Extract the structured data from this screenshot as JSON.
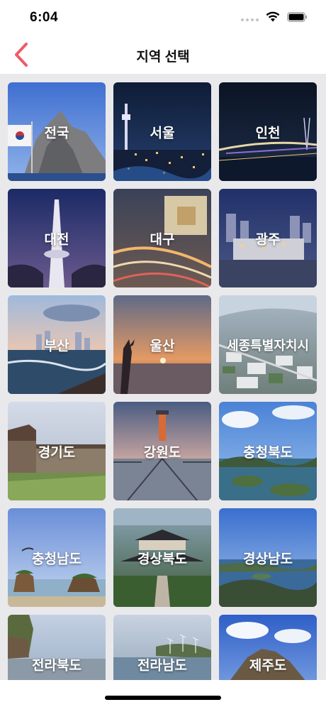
{
  "status_bar": {
    "time": "6:04"
  },
  "nav": {
    "title": "지역 선택",
    "accent_color": "#ef5b67"
  },
  "regions": [
    {
      "label": "전국",
      "scene": "national-flag-rock-island"
    },
    {
      "label": "서울",
      "scene": "seoul-night-tower"
    },
    {
      "label": "인천",
      "scene": "incheon-bridge-night"
    },
    {
      "label": "대전",
      "scene": "daejeon-tower-dusk"
    },
    {
      "label": "대구",
      "scene": "daegu-traffic-night"
    },
    {
      "label": "광주",
      "scene": "gwangju-city-dusk"
    },
    {
      "label": "부산",
      "scene": "busan-beach-sunset"
    },
    {
      "label": "울산",
      "scene": "ulsan-sunrise-sea"
    },
    {
      "label": "세종특별자치시",
      "scene": "sejong-aerial-city"
    },
    {
      "label": "경기도",
      "scene": "gyeonggi-fortress-wall"
    },
    {
      "label": "강원도",
      "scene": "gangwon-lighthouse-pier"
    },
    {
      "label": "충청북도",
      "scene": "chungbuk-lake-islands"
    },
    {
      "label": "충청남도",
      "scene": "chungnam-rock-islets"
    },
    {
      "label": "경상북도",
      "scene": "gyeongbuk-temple-aerial"
    },
    {
      "label": "경상남도",
      "scene": "gyeongnam-coastal-hills"
    },
    {
      "label": "전라북도",
      "scene": "jeonbuk-coastal-cliff"
    },
    {
      "label": "전라남도",
      "scene": "jeonnam-windfarm-coast"
    },
    {
      "label": "제주도",
      "scene": "jeju-mountain-fields"
    }
  ]
}
